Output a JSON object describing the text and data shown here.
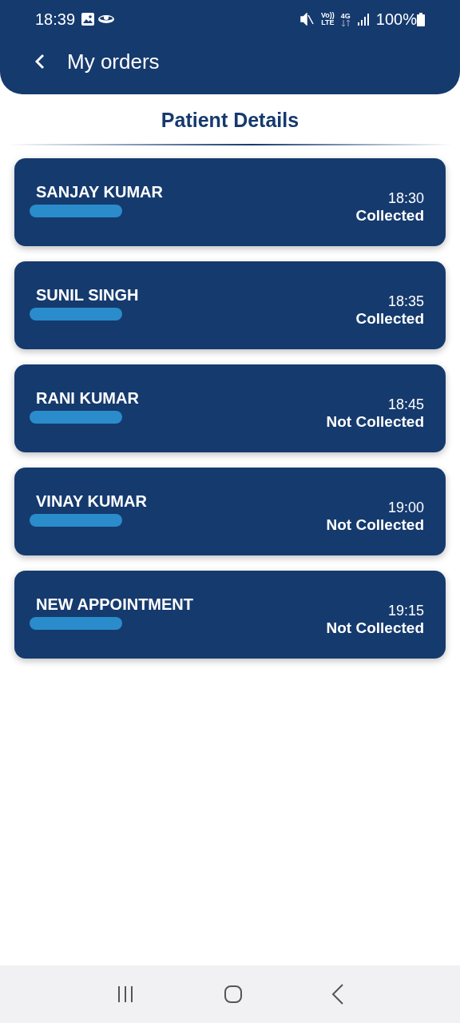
{
  "status_bar": {
    "time": "18:39",
    "volte_top": "Vo))",
    "volte_bottom": "LTE",
    "network": "4G",
    "battery": "100%"
  },
  "app_bar": {
    "title": "My orders"
  },
  "section_title": "Patient Details",
  "orders": [
    {
      "name": "SANJAY KUMAR",
      "time": "18:30",
      "status": "Collected",
      "redacted": true
    },
    {
      "name": "SUNIL SINGH",
      "time": "18:35",
      "status": "Collected",
      "redacted": true
    },
    {
      "name": "RANI KUMAR",
      "time": "18:45",
      "status": "Not Collected",
      "redacted": true
    },
    {
      "name": "VINAY KUMAR",
      "time": "19:00",
      "status": "Not Collected",
      "redacted": true
    },
    {
      "name": "NEW APPOINTMENT",
      "time": "19:15",
      "status": "Not Collected",
      "redacted": true
    }
  ]
}
